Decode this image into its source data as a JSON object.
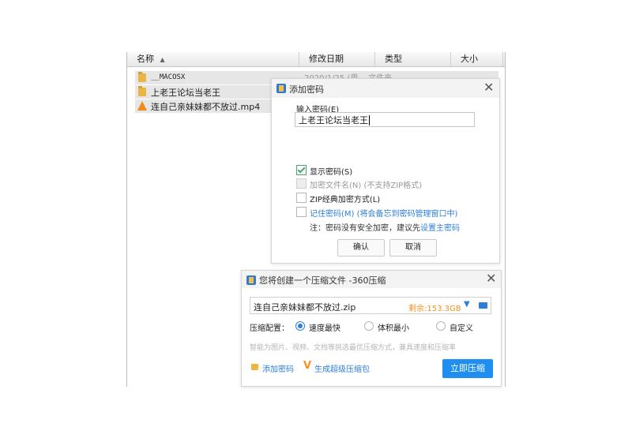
{
  "explorer": {
    "columns": [
      "名称",
      "修改日期",
      "类型",
      "大小"
    ],
    "files": [
      {
        "name": "__MACOSX",
        "meta": "2020/1/25 (周...    文件夹"
      },
      {
        "name": "上老王论坛当老王",
        "meta": ""
      },
      {
        "name": "连自己亲妹妹都不放过.mp4",
        "meta": ""
      }
    ]
  },
  "password_dialog": {
    "title": "添加密码",
    "input_label": "输入密码(E)",
    "input_value": "上老王论坛当老王",
    "options": {
      "show_password": "显示密码(S)",
      "encrypt_filenames": "加密文件名(N) (不支持ZIP格式)",
      "zip_classic": "ZIP经典加密方式(L)",
      "remember_password": "记住密码(M) (将会备忘到密码管理窗口中)"
    },
    "note_prefix": "注：密码没有安全加密，建议先",
    "note_link": "设置主密码",
    "ok_label": "确认",
    "cancel_label": "取消",
    "accent_color": "#2d7fd8"
  },
  "zip_dialog": {
    "title": "您将创建一个压缩文件 -360压缩",
    "filename": "连自己亲妹妹都不放过.zip",
    "free_space": "剩余:153.3GB",
    "config_label": "压缩配置：",
    "options": [
      "速度最快",
      "体积最小",
      "自定义"
    ],
    "selected_option": "速度最快",
    "hint": "智能为图片、视频、文档等挑选最优压缩方式，兼具速度和压缩率",
    "add_password_label": "添加密码",
    "super_package_label": "生成超级压缩包",
    "compress_label": "立即压缩",
    "primary_color": "#1e8ff0",
    "warning_color": "#f29322"
  }
}
